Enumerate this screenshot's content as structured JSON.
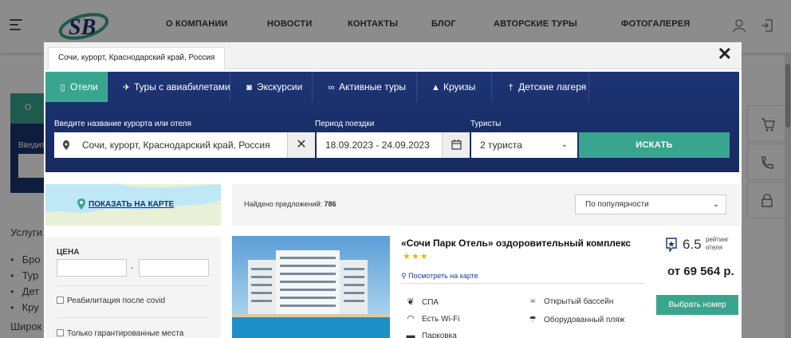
{
  "header": {
    "nav": [
      "О КОМПАНИИ",
      "НОВОСТИ",
      "КОНТАКТЫ",
      "БЛОГ",
      "АВТОРСКИЕ ТУРЫ",
      "ФОТОГАЛЕРЕЯ"
    ],
    "icons": [
      "menu-icon",
      "user-icon",
      "logout-icon"
    ]
  },
  "background": {
    "tab_partial": "О",
    "field_label_partial": "Введит",
    "side_title": "Услуги",
    "list": [
      "Бро",
      "Тур",
      "Дет",
      "Кру"
    ],
    "wide_text": "Широк"
  },
  "modal": {
    "location_tab": "Сочи, курорт, Краснодарский край, Россия",
    "close_symbol": "✕",
    "tabs": [
      {
        "label": "Отели",
        "icon": "hotel-icon",
        "active": true
      },
      {
        "label": "Туры с авиабилетами",
        "icon": "plane-icon",
        "active": false
      },
      {
        "label": "Экскурсии",
        "icon": "camera-icon",
        "active": false
      },
      {
        "label": "Активные туры",
        "icon": "bicycle-icon",
        "active": false
      },
      {
        "label": "Круизы",
        "icon": "ship-icon",
        "active": false
      },
      {
        "label": "Детские лагеря",
        "icon": "child-icon",
        "active": false
      }
    ],
    "search": {
      "destination_label": "Введите название курорта или отеля",
      "destination_value": "Сочи, курорт, Краснодарский край, Россия",
      "period_label": "Период поездки",
      "period_value": "18.09.2023 - 24.09.2023",
      "tourists_label": "Туристы",
      "tourists_value": "2 туриста",
      "button": "ИСКАТЬ"
    },
    "map_link": "ПОКАЗАТЬ НА КАРТЕ",
    "filters": {
      "price_title": "ЦЕНА",
      "price_dash": "-",
      "checkbox_1": "Реабилитация после covid",
      "checkbox_2": "Только гарантированные места"
    },
    "results": {
      "found_label": "Найдено предложений:",
      "found_count": "786",
      "sort_value": "По популярности"
    },
    "hotel": {
      "name": "«Сочи Парк Отель» оздоровительный комплекс",
      "stars": 3,
      "stars_text": "★★★",
      "map_link": "Посмотреть на карте",
      "amenities": [
        {
          "label": "СПА",
          "icon": "lotus-icon"
        },
        {
          "label": "Открытый бассейн",
          "icon": "swimmer-icon"
        },
        {
          "label": "Есть Wi-Fi",
          "icon": "wifi-icon"
        },
        {
          "label": "Оборудованный пляж",
          "icon": "beach-umbrella-icon"
        },
        {
          "label": "Парковка",
          "icon": "car-icon"
        }
      ],
      "rating": "6.5",
      "rating_label": "рейтинг отеля",
      "price": "от 69 564 р.",
      "choose_button": "Выбрать номер"
    }
  },
  "colors": {
    "accent": "#3aa58f",
    "search_bg": "#1b3370",
    "link": "#1b3a9c",
    "stars": "#f0b400"
  }
}
